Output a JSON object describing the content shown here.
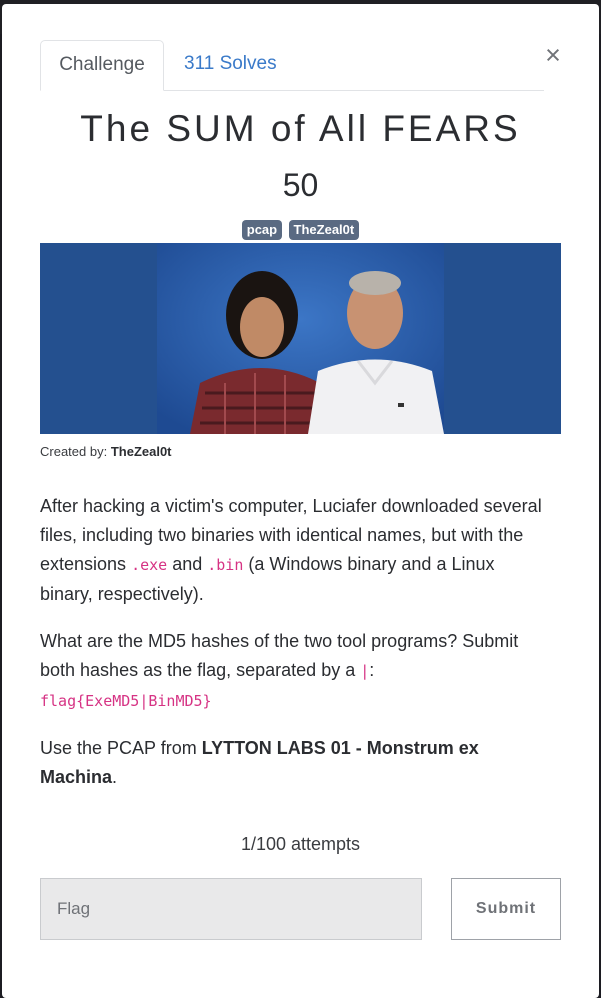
{
  "tabs": {
    "challenge": "Challenge",
    "solves": "311 Solves"
  },
  "close_icon": "×",
  "challenge": {
    "title": "The SUM of All FEARS",
    "value": "50",
    "tags": [
      "pcap",
      "TheZeal0t"
    ],
    "banner_image": "photo of two men on blue background",
    "created_by_label": "Created by: ",
    "created_by": "TheZeal0t",
    "description": {
      "p1_a": "After hacking a victim's computer, Luciafer downloaded several files, including two binaries with identical names, but with the extensions ",
      "p1_code1": ".exe",
      "p1_b": " and ",
      "p1_code2": ".bin",
      "p1_c": " (a Windows binary and a Linux binary, respectively).",
      "p2_a": "What are the MD5 hashes of the two tool programs? Submit both hashes as the flag, separated by a ",
      "p2_code1": "|",
      "p2_b": ":",
      "p2_code2": "flag{ExeMD5|BinMD5}",
      "p3_a": "Use the PCAP from ",
      "p3_bold": "LYTTON LABS 01 - Monstrum ex Machina",
      "p3_b": "."
    }
  },
  "attempts": "1/100 attempts",
  "form": {
    "flag_placeholder": "Flag",
    "flag_value": "",
    "submit_label": "Submit"
  },
  "colors": {
    "accent_link": "#3a7ac9",
    "tag_bg": "#5a6a82",
    "code": "#d63384",
    "banner_bg": "#2a5ba8"
  }
}
